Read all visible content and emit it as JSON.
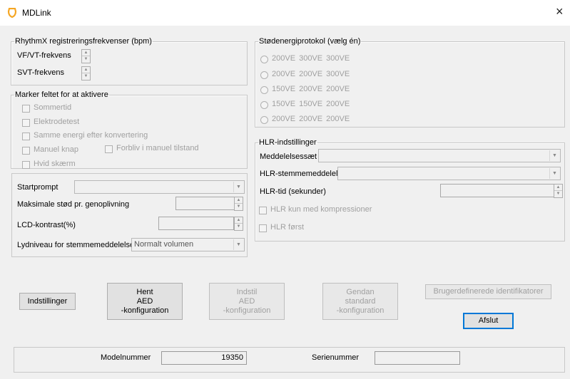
{
  "window": {
    "title": "MDLink",
    "close_symbol": "×"
  },
  "rhythmx": {
    "legend": "RhythmX registreringsfrekvenser (bpm)",
    "vf_label": "VF/VT-frekvens",
    "svt_label": "SVT-frekvens"
  },
  "activate": {
    "legend": "Marker feltet for at aktivere",
    "items": [
      "Sommertid",
      "Elektrodetest",
      "Samme energi efter konvertering",
      "Manuel knap",
      "Forbliv i manuel tilstand",
      "Hvid skærm"
    ]
  },
  "settings": {
    "startprompt_label": "Startprompt",
    "maxshocks_label": "Maksimale stød pr. genoplivning",
    "lcd_label": "LCD-kontrast(%)",
    "sound_label": "Lydniveau for stemmemeddelelser",
    "sound_value": "Normalt volumen"
  },
  "energy": {
    "legend": "Stødenergiprotokol (vælg én)",
    "options": [
      "200VE   300VE   300VE",
      "200VE   200VE   300VE",
      "150VE   200VE   200VE",
      "150VE   150VE   200VE",
      "200VE   200VE   200VE"
    ]
  },
  "hlr": {
    "legend": "HLR-indstillinger",
    "message_set_label": "Meddelelsessæt",
    "voice_label": "HLR-stemmemeddelelse",
    "time_label": "HLR-tid (sekunder)",
    "compression_only": "HLR kun med kompressioner",
    "hlr_first": "HLR først"
  },
  "buttons": {
    "settings": "Indstillinger",
    "get_aed": "Hent\nAED\n-konfiguration",
    "set_aed": "Indstil\nAED\n-konfiguration",
    "restore": "Gendan\nstandard\n-konfiguration",
    "custom_ids": "Brugerdefinerede identifikatorer",
    "exit": "Afslut"
  },
  "device": {
    "model_label": "Modelnummer",
    "model_value": "19350",
    "serial_label": "Serienummer",
    "serial_value": ""
  },
  "colors": {
    "accent": "#0078d7",
    "disabled_text": "#a0a0a0",
    "icon": "#f5a623"
  }
}
